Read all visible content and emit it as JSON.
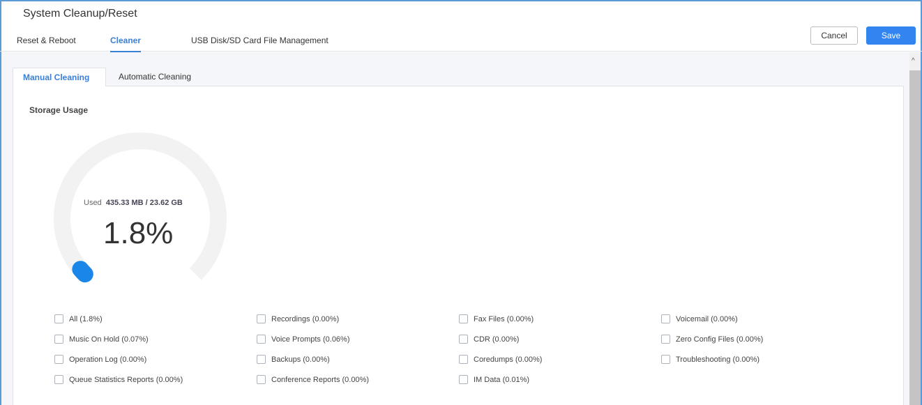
{
  "header": {
    "title": "System Cleanup/Reset",
    "tabs": [
      {
        "label": "Reset & Reboot"
      },
      {
        "label": "Cleaner"
      },
      {
        "label": "USB Disk/SD Card File Management"
      }
    ],
    "cancel_label": "Cancel",
    "save_label": "Save"
  },
  "inner_tabs": [
    {
      "label": "Manual Cleaning"
    },
    {
      "label": "Automatic Cleaning"
    }
  ],
  "storage": {
    "label": "Storage Usage",
    "used_label": "Used",
    "used_value": "435.33 MB / 23.62 GB",
    "percent_text": "1.8%",
    "percent_value": 1.8,
    "accent_color": "#1a86e8",
    "track_color": "#f2f2f2"
  },
  "options": [
    {
      "label": "All (1.8%)"
    },
    {
      "label": "Recordings (0.00%)"
    },
    {
      "label": "Fax Files (0.00%)"
    },
    {
      "label": "Voicemail (0.00%)"
    },
    {
      "label": "Music On Hold (0.07%)"
    },
    {
      "label": "Voice Prompts (0.06%)"
    },
    {
      "label": "CDR (0.00%)"
    },
    {
      "label": "Zero Config Files (0.00%)"
    },
    {
      "label": "Operation Log (0.00%)"
    },
    {
      "label": "Backups (0.00%)"
    },
    {
      "label": "Coredumps (0.00%)"
    },
    {
      "label": "Troubleshooting (0.00%)"
    },
    {
      "label": "Queue Statistics Reports (0.00%)"
    },
    {
      "label": "Conference Reports (0.00%)"
    },
    {
      "label": "IM Data (0.01%)"
    }
  ],
  "icons": {
    "scroll_up": "chevron-up-icon"
  }
}
